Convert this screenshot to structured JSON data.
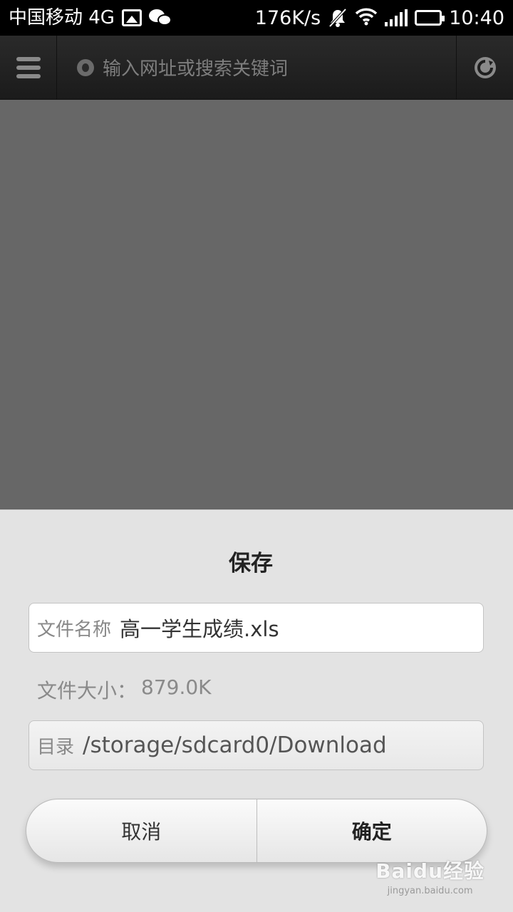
{
  "status_bar": {
    "carrier": "中国移动 4G",
    "speed": "176K/s",
    "time": "10:40",
    "icons": [
      "gallery-icon",
      "wechat-icon",
      "mute-bell-icon",
      "wifi-icon",
      "signal-icon",
      "battery-icon"
    ]
  },
  "toolbar": {
    "address_placeholder": "输入网址或搜索关键词",
    "menu_icon": "menu-icon",
    "reload_icon": "reload-icon"
  },
  "dialog": {
    "title": "保存",
    "file_name_label": "文件名称",
    "file_name_value": "高一学生成绩.xls",
    "file_size_label": "文件大小：",
    "file_size_value": "879.0K",
    "directory_label": "目录",
    "directory_value": "/storage/sdcard0/Download",
    "cancel_label": "取消",
    "confirm_label": "确定"
  },
  "watermark": {
    "logo": "Baidu经验",
    "url": "jingyan.baidu.com"
  },
  "colors": {
    "status_bar_bg": "#000000",
    "toolbar_bg": "#222222",
    "overlay": "#676767",
    "dialog_bg": "#e3e3e3"
  }
}
